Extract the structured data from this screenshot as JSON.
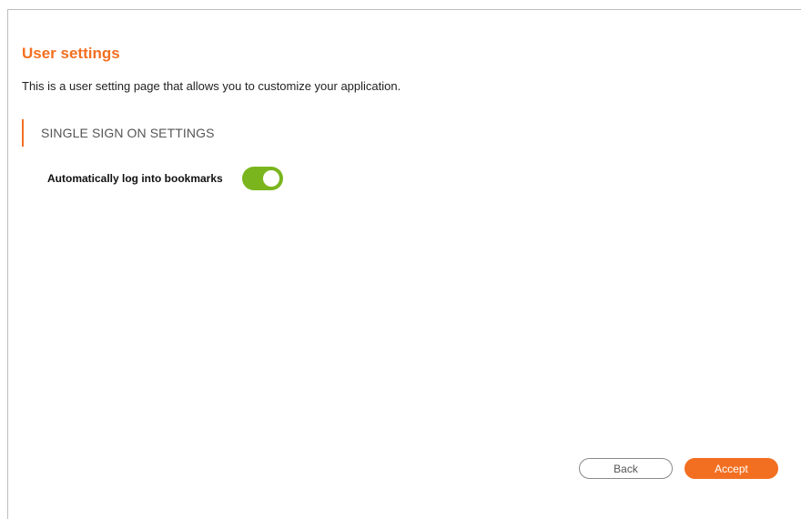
{
  "page": {
    "title": "User settings",
    "description": "This is a user setting page that allows you to customize your application."
  },
  "section": {
    "title": "SINGLE SIGN ON SETTINGS"
  },
  "settings": [
    {
      "label": "Automatically log into bookmarks",
      "enabled": true
    }
  ],
  "buttons": {
    "back_label": "Back",
    "accept_label": "Accept"
  },
  "colors": {
    "accent": "#f26f21",
    "toggle_on": "#7ab51d"
  }
}
